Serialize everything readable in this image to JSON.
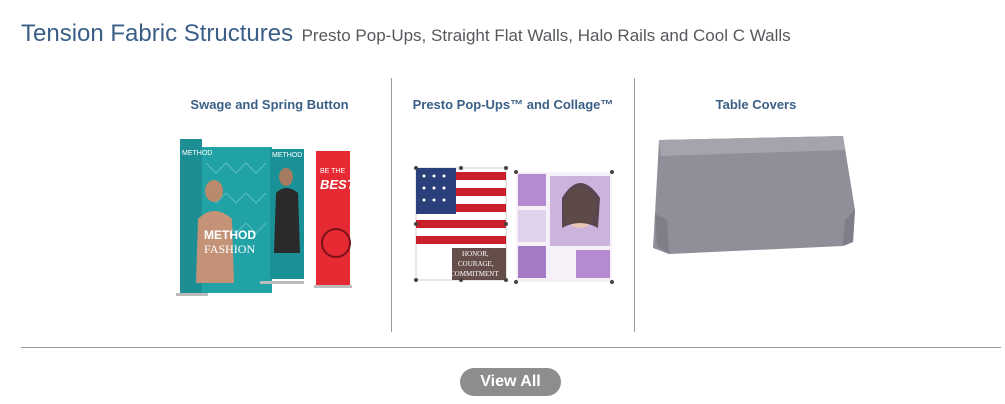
{
  "header": {
    "title": "Tension Fabric Structures",
    "subtitle": "Presto Pop-Ups, Straight Flat Walls, Halo Rails and Cool C Walls"
  },
  "categories": [
    {
      "label": "Swage and Spring Button",
      "image_text": [
        "METHOD",
        "METHOD",
        "FASHION",
        "BE THE",
        "BEST"
      ]
    },
    {
      "label": "Presto Pop-Ups™ and Collage™",
      "image_text": [
        "HONOR,",
        "COURAGE,",
        "COMMITMENT"
      ]
    },
    {
      "label": "Table Covers",
      "image_text": []
    }
  ],
  "footer": {
    "view_all_label": "View All"
  },
  "colors": {
    "title_blue": "#3b5f86",
    "divider_gray": "#9a9a9a",
    "button_gray": "#8d8d8d"
  }
}
